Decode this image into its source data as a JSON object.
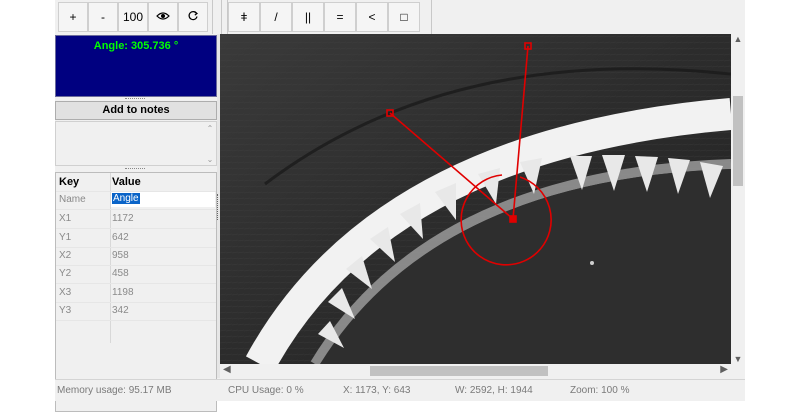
{
  "toolbar": {
    "zoom_in": "+",
    "zoom_out": "-",
    "zoom_100": "100",
    "view_icon": "eye-icon",
    "refresh_icon": "rotate-icon",
    "tools": [
      {
        "glyph": "ǂ",
        "name": "vertical-line-tool"
      },
      {
        "glyph": "/",
        "name": "diagonal-line-tool"
      },
      {
        "glyph": "||",
        "name": "parallel-lines-tool"
      },
      {
        "glyph": "=",
        "name": "horizontal-lines-tool"
      },
      {
        "glyph": "<",
        "name": "angle-tool"
      },
      {
        "glyph": "□",
        "name": "rectangle-tool"
      }
    ]
  },
  "measurement": {
    "angle_label": "Angle: 305.736 °"
  },
  "notes": {
    "button_label": "Add to notes"
  },
  "properties": {
    "headers": {
      "key": "Key",
      "value": "Value"
    },
    "rows": [
      {
        "key": "Name",
        "value": "Angle"
      },
      {
        "key": "X1",
        "value": "1172"
      },
      {
        "key": "Y1",
        "value": "642"
      },
      {
        "key": "X2",
        "value": "958"
      },
      {
        "key": "Y2",
        "value": "458"
      },
      {
        "key": "X3",
        "value": "1198"
      },
      {
        "key": "Y3",
        "value": "342"
      }
    ]
  },
  "status": {
    "memory": "Memory usage: 95.17 MB",
    "cpu": "CPU Usage: 0 %",
    "cursor": "X: 1173, Y: 643",
    "size": "W: 2592, H: 1944",
    "zoom": "Zoom: 100 %"
  },
  "colors": {
    "angle_panel_bg": "#000080",
    "angle_text": "#00ff00",
    "overlay": "#e00000"
  }
}
